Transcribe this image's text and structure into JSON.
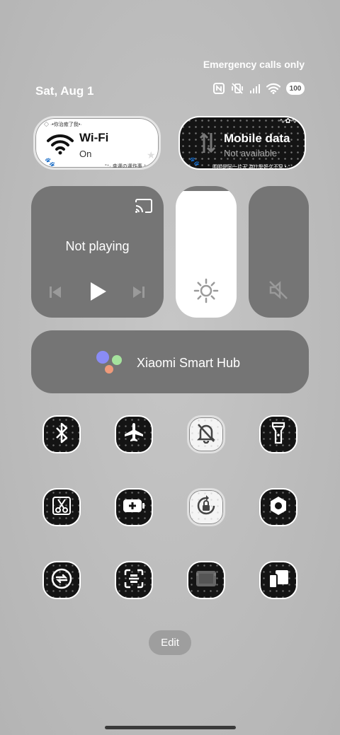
{
  "status": {
    "emergency_text": "Emergency calls only",
    "date": "Sat, Aug 1",
    "battery": "100"
  },
  "wifi_tile": {
    "title": "Wi-Fi",
    "state": "On",
    "deco_top": "◇ ·•你治癒了我•·",
    "deco_bottom": "°⁺· 幸運の運作事 ⁺"
  },
  "mobile_tile": {
    "title": "Mobile data",
    "state": "Not available",
    "deco_bottom": "明明是同一片天 為什麼好久不見 •·°"
  },
  "media": {
    "status": "Not playing"
  },
  "brightness": {
    "level": 0.96
  },
  "hub": {
    "label": "Xiaomi Smart Hub"
  },
  "toggles": [
    {
      "icon": "bluetooth-icon"
    },
    {
      "icon": "airplane-icon"
    },
    {
      "icon": "silent-bell-icon"
    },
    {
      "icon": "flashlight-icon"
    },
    {
      "icon": "screenshot-scissors-icon"
    },
    {
      "icon": "battery-saver-icon"
    },
    {
      "icon": "rotation-lock-icon"
    },
    {
      "icon": "settings-nut-icon"
    },
    {
      "icon": "sync-icon"
    },
    {
      "icon": "scanner-icon"
    },
    {
      "icon": "screen-cast-icon"
    },
    {
      "icon": "devices-icon"
    }
  ],
  "edit_label": "Edit"
}
